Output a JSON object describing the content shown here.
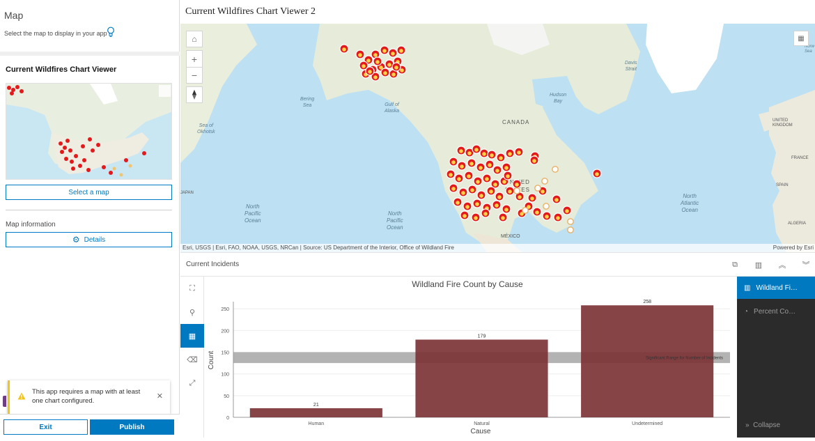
{
  "left_panel": {
    "title": "Map",
    "subtitle": "Select the map to display in your app",
    "card_title": "Current Wildfires Chart Viewer",
    "select_map_label": "Select a map",
    "info_label": "Map information",
    "details_label": "Details",
    "toast_message": "This app requires a map with at least one chart configured.",
    "exit_label": "Exit",
    "publish_label": "Publish"
  },
  "app": {
    "title": "Current Wildfires Chart Viewer 2"
  },
  "map": {
    "attribution": "Esri, USGS | Esri, FAO, NOAA, USGS, NRCan | Source: US Department of the Interior, Office of Wildland Fire",
    "powered_by": "Powered by Esri",
    "labels": {
      "canada": "CANADA",
      "united_states": "UNITED\nSTATES",
      "mexico": "MÉXICO",
      "bering": "Bering\nSea",
      "gulf_alaska": "Gulf of\nAlaska",
      "okhotsk": "Sea of\nOkhotsk",
      "hudson": "Hudson\nBay",
      "davis": "Davis\nStrait",
      "north_atlantic": "North\nAtlantic\nOcean",
      "north_pacific_1": "North\nPacific\nOcean",
      "north_pacific_2": "North\nPacific\nOcean",
      "uk": "UNITED\nKINGDOM",
      "france": "FRANCE",
      "spain": "SPAIN",
      "algeria": "ALGERIA",
      "japan": "JAPAN",
      "norw": "Norw\nSea"
    }
  },
  "chart_panel": {
    "header_label": "Current Incidents",
    "series_items": [
      {
        "label": "Wildland Fi…",
        "active": true
      },
      {
        "label": "Percent Co…",
        "active": false
      }
    ],
    "collapse_label": "Collapse"
  },
  "chart_data": {
    "type": "bar",
    "title": "Wildland Fire Count by Cause",
    "xlabel": "Cause",
    "ylabel": "Count",
    "categories": [
      "Human",
      "Natural",
      "Undetermined"
    ],
    "values": [
      21,
      179,
      258
    ],
    "ylim": [
      0,
      260
    ],
    "yticks": [
      0,
      50,
      100,
      150,
      200,
      250
    ],
    "bar_color": "#7d3437",
    "guide": {
      "label": "Significant Range for Number of Incidents",
      "range": [
        125,
        150
      ],
      "color": "#9a9a9a"
    }
  },
  "colors": {
    "accent": "#0079c1",
    "fire_red": "#e31a1c",
    "fire_yellow": "#ffd700"
  }
}
